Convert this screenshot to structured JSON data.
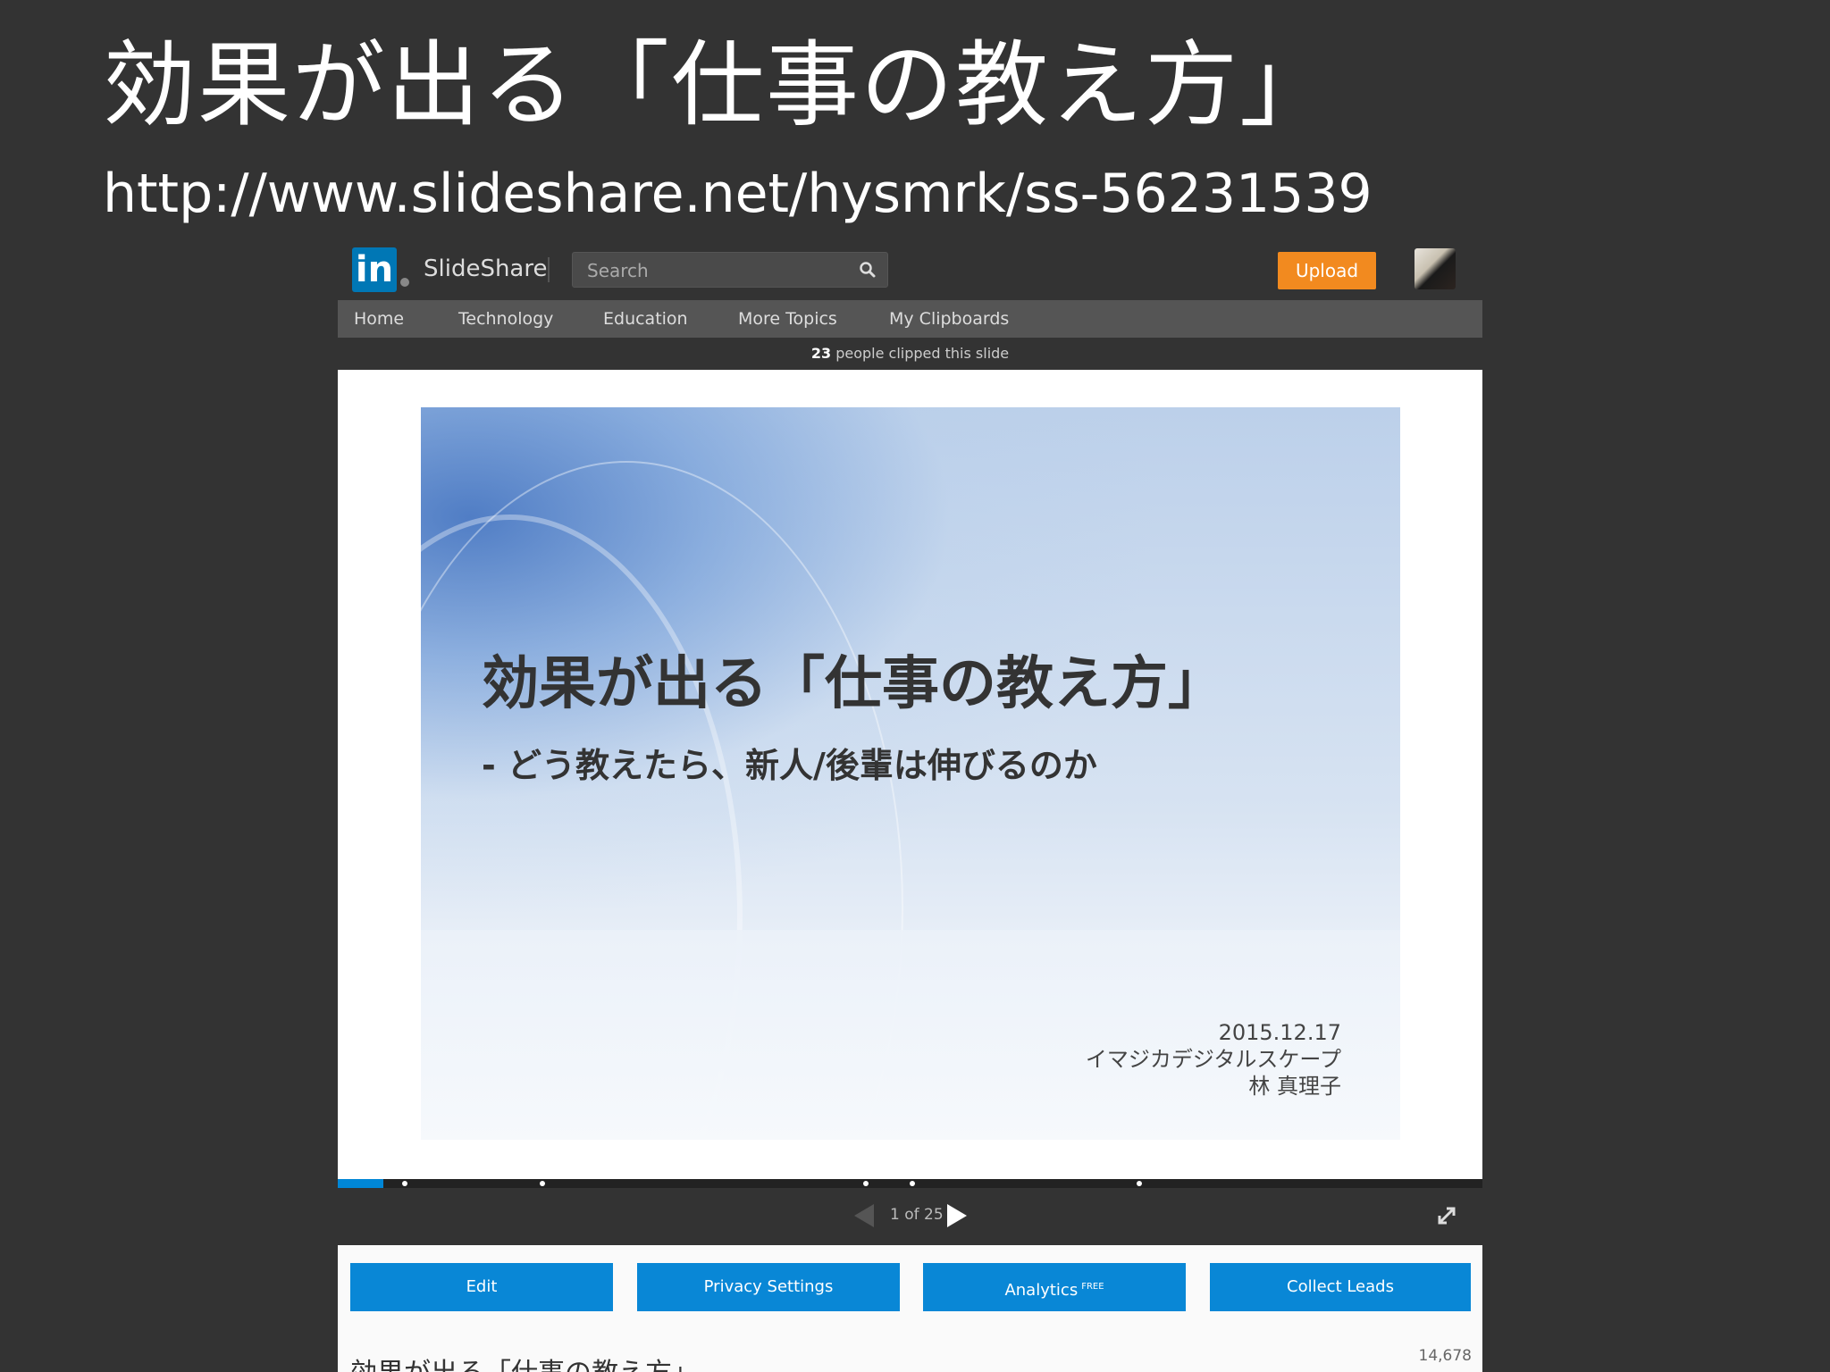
{
  "page": {
    "title": "効果が出る「仕事の教え方」",
    "url": "http://www.slideshare.net/hysmrk/ss-56231539"
  },
  "header": {
    "logo_mark": "in",
    "logo_text": "SlideShare",
    "search_placeholder": "Search",
    "upload_label": "Upload"
  },
  "nav": {
    "items": [
      "Home",
      "Technology",
      "Education",
      "More Topics",
      "My Clipboards"
    ]
  },
  "clip_bar": {
    "count": "23",
    "text": "people clipped this slide"
  },
  "slide": {
    "title": "効果が出る「仕事の教え方」",
    "subtitle": "- どう教えたら、新人/後輩は伸びるのか",
    "date": "2015.12.17",
    "company": "イマジカデジタルスケープ",
    "author": "林 真理子"
  },
  "player": {
    "page_indicator": "1 of 25",
    "progress_fraction": 0.04
  },
  "actions": {
    "edit": "Edit",
    "privacy": "Privacy Settings",
    "analytics": "Analytics",
    "analytics_tag": "FREE",
    "collect_leads": "Collect Leads"
  },
  "document": {
    "title": "効果が出る「仕事の教え方」",
    "views": "14,678"
  },
  "colors": {
    "background": "#333333",
    "linkedin_blue": "#0077b5",
    "upload_orange": "#f28a1f",
    "action_blue": "#0987d6"
  }
}
